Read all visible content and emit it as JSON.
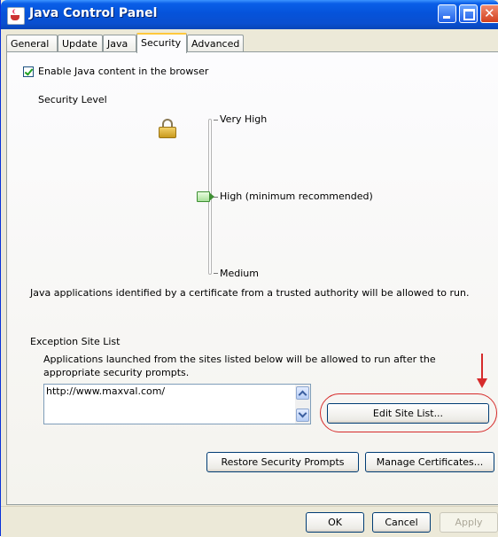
{
  "window": {
    "title": "Java Control Panel"
  },
  "tabs": [
    {
      "label": "General"
    },
    {
      "label": "Update"
    },
    {
      "label": "Java"
    },
    {
      "label": "Security",
      "active": true
    },
    {
      "label": "Advanced"
    }
  ],
  "security": {
    "enable_label": "Enable Java content in the browser",
    "enable_checked": true,
    "level_title": "Security Level",
    "levels": [
      "Very High",
      "High (minimum recommended)",
      "Medium"
    ],
    "selected_level": "High (minimum recommended)",
    "description": "Java applications identified by a certificate from a trusted authority will be allowed to run."
  },
  "exception": {
    "title": "Exception Site List",
    "description": "Applications launched from the sites listed below will be allowed to run after the appropriate security prompts.",
    "sites": [
      "http://www.maxval.com/"
    ],
    "edit_button": "Edit Site List..."
  },
  "buttons": {
    "restore": "Restore Security Prompts",
    "manage": "Manage Certificates...",
    "ok": "OK",
    "cancel": "Cancel",
    "apply": "Apply"
  },
  "annotation_color": "#d62b2b"
}
